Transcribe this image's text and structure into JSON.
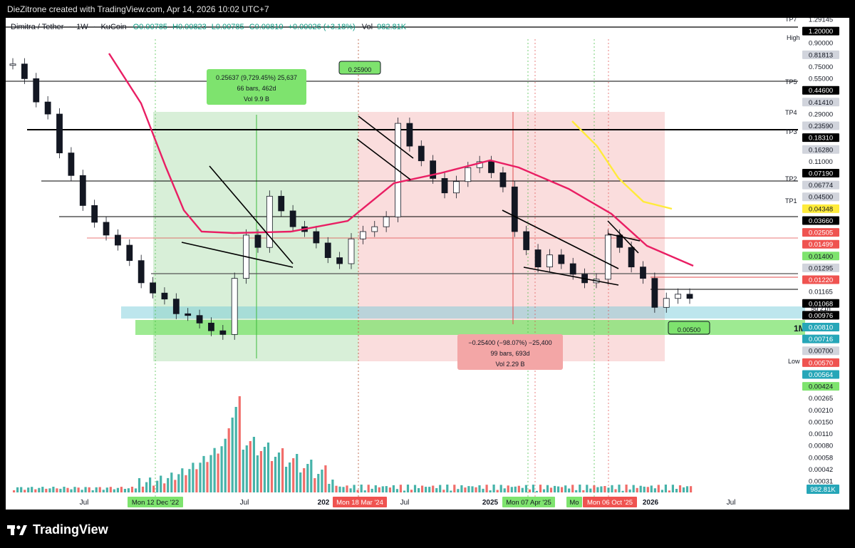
{
  "header": {
    "credit": "DieZitrone created with TradingView.com, Apr 14, 2026 10:02 UTC+7"
  },
  "chart": {
    "pair": "Dimitra / Tether",
    "interval": "1W",
    "exchange": "KuCoin",
    "ohlc": {
      "o": "O0.00785",
      "h": "H0.00823",
      "l": "L0.00785",
      "c": "C0.00810",
      "change": "+0.00026 (+3.18%)"
    },
    "vol_label": "Vol",
    "vol_value": "982.81K",
    "colors": {
      "up": "#26a69a",
      "down": "#ef5350",
      "ma": "#e91e63",
      "ma_slow": "#ffeb3b",
      "pattern": "#000000",
      "long_box": "#8fd18f",
      "short_box": "#f5b3b3",
      "zone": "#6cc7d6",
      "support": "#7ee36e"
    }
  },
  "labels": {
    "ath_flag": "0.25900",
    "atl_flag": "0.00500",
    "long_stats": [
      "0.25637 (9,729.45%) 25,637",
      "66 bars, 462d",
      "Vol 9.9 B"
    ],
    "short_stats": [
      "−0.25400 (−98.07%) −25,400",
      "99 bars, 693d",
      "Vol 2.29 B"
    ],
    "zone_tag": "1M",
    "tp": [
      "TP1",
      "TP2",
      "TP3",
      "TP4",
      "TP5",
      "TP7"
    ]
  },
  "price_axis": {
    "high_tag": "High",
    "low_tag": "Low",
    "ticks": [
      "1.29145",
      "1.20000",
      "0.90000",
      "0.81813",
      "0.75000",
      "0.55000",
      "0.44600",
      "0.41410",
      "0.29000",
      "0.23590",
      "0.18310",
      "0.16280",
      "0.11000",
      "0.07190",
      "0.06774",
      "0.04500",
      "0.04348",
      "0.03660",
      "0.02505",
      "0.01499",
      "0.01400",
      "0.01295",
      "0.01220",
      "0.01165",
      "0.01068",
      "0.00976",
      "0.00810",
      "0.00716",
      "0.00700",
      "0.00570",
      "0.00564",
      "0.00424",
      "0.00265",
      "0.00210",
      "0.00150",
      "0.00110",
      "0.00080",
      "0.00058",
      "0.00042",
      "0.00031"
    ],
    "countdown": "5d 21h",
    "vol_tag": "982.81K"
  },
  "time_axis": {
    "ticks": [
      "Jul",
      "Jul",
      "202",
      "Jul",
      "2025",
      "2026",
      "Jul"
    ],
    "badges": [
      "Mon 12 Dec '22",
      "Mon 18 Mar '24",
      "Mon 07 Apr '25",
      "Mo",
      "Mon 06 Oct '25"
    ]
  },
  "footer": {
    "brand": "TradingView"
  },
  "chart_data": {
    "type": "candlestick",
    "title": "Dimitra / Tether · 1W · KuCoin",
    "y_scale": "log",
    "ylim": [
      0.0025,
      1.3
    ],
    "series": [
      {
        "name": "price",
        "points": [
          [
            "2021-06",
            0.8
          ],
          [
            "2021-07",
            0.6
          ],
          [
            "2021-08",
            0.38
          ],
          [
            "2021-09",
            0.3
          ],
          [
            "2021-10",
            0.14
          ],
          [
            "2021-11",
            0.09
          ],
          [
            "2021-12",
            0.05
          ],
          [
            "2022-01",
            0.036
          ],
          [
            "2022-02",
            0.028
          ],
          [
            "2022-03",
            0.023
          ],
          [
            "2022-04",
            0.017
          ],
          [
            "2022-05",
            0.011
          ],
          [
            "2022-06",
            0.009
          ],
          [
            "2022-07",
            0.008
          ],
          [
            "2022-08",
            0.006
          ],
          [
            "2022-09",
            0.0058
          ],
          [
            "2022-10",
            0.005
          ],
          [
            "2022-11",
            0.0043
          ],
          [
            "2022-12",
            0.004
          ],
          [
            "2023-01",
            0.012
          ],
          [
            "2023-02",
            0.028
          ],
          [
            "2023-03",
            0.022
          ],
          [
            "2023-04",
            0.06
          ],
          [
            "2023-05",
            0.045
          ],
          [
            "2023-06",
            0.033
          ],
          [
            "2023-07",
            0.03
          ],
          [
            "2023-08",
            0.024
          ],
          [
            "2023-09",
            0.018
          ],
          [
            "2023-10",
            0.016
          ],
          [
            "2023-11",
            0.026
          ],
          [
            "2023-12",
            0.03
          ],
          [
            "2024-01",
            0.033
          ],
          [
            "2024-02",
            0.04
          ],
          [
            "2024-03",
            0.25
          ],
          [
            "2024-04",
            0.16
          ],
          [
            "2024-05",
            0.12
          ],
          [
            "2024-06",
            0.085
          ],
          [
            "2024-07",
            0.064
          ],
          [
            "2024-08",
            0.08
          ],
          [
            "2024-09",
            0.105
          ],
          [
            "2024-10",
            0.118
          ],
          [
            "2024-11",
            0.095
          ],
          [
            "2024-12",
            0.072
          ],
          [
            "2025-01",
            0.03
          ],
          [
            "2025-02",
            0.021
          ],
          [
            "2025-03",
            0.015
          ],
          [
            "2025-04",
            0.019
          ],
          [
            "2025-05",
            0.016
          ],
          [
            "2025-06",
            0.013
          ],
          [
            "2025-07",
            0.011
          ],
          [
            "2025-08",
            0.0118
          ],
          [
            "2025-09",
            0.028
          ],
          [
            "2025-10",
            0.022
          ],
          [
            "2025-11",
            0.015
          ],
          [
            "2025-12",
            0.012
          ],
          [
            "2026-01",
            0.0068
          ],
          [
            "2026-02",
            0.0081
          ],
          [
            "2026-03",
            0.0088
          ],
          [
            "2026-04",
            0.0081
          ]
        ]
      }
    ],
    "annotations": [
      {
        "label": "0.25637 (9,729.45%) 25,637",
        "type": "long_position"
      },
      {
        "label": "−0.25400 (−98.07%) −25,400",
        "type": "short_position"
      },
      {
        "label": "0.25900",
        "type": "price_flag"
      },
      {
        "label": "0.00500",
        "type": "price_flag"
      }
    ]
  }
}
